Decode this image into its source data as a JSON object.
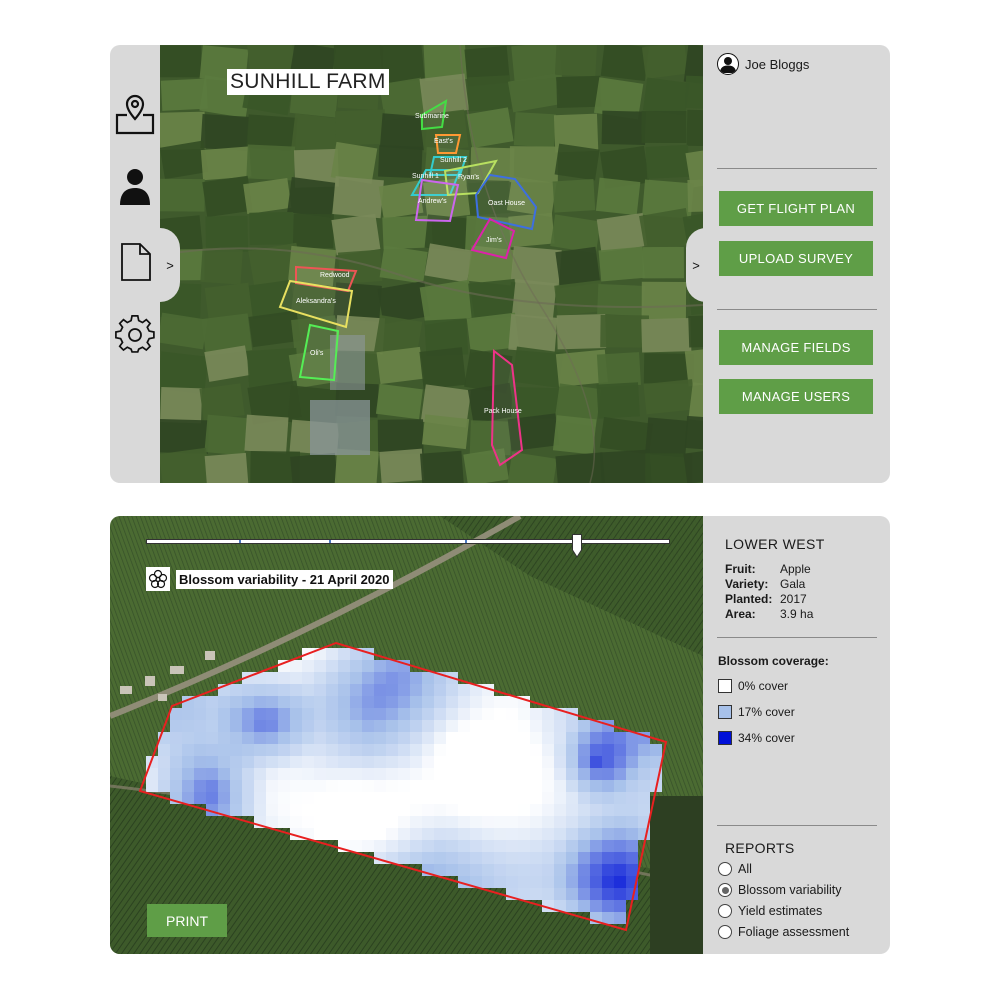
{
  "top_panel": {
    "farm_name": "SUNHILL FARM",
    "user_name": "Joe Bloggs",
    "nav_icons": [
      "map-pin-icon",
      "user-icon",
      "document-icon",
      "gear-icon"
    ],
    "left_toggle": ">",
    "right_toggle": ">",
    "buttons": {
      "get_flight_plan": "GET FLIGHT PLAN",
      "upload_survey": "UPLOAD SURVEY",
      "manage_fields": "MANAGE FIELDS",
      "manage_users": "MANAGE USERS"
    },
    "fields": [
      "Submarine",
      "East's",
      "Sunhill 2",
      "Sunhill 1",
      "Ryan's",
      "Andrew's",
      "Oast House",
      "Jim's",
      "Redwood",
      "Aleksandra's",
      "Oli's",
      "Pack House"
    ]
  },
  "bottom_panel": {
    "caption": "Blossom variability - 21 April 2020",
    "print_label": "PRINT",
    "field": {
      "name": "LOWER WEST",
      "fruit_label": "Fruit:",
      "fruit": "Apple",
      "variety_label": "Variety:",
      "variety": "Gala",
      "planted_label": "Planted:",
      "planted": "2017",
      "area_label": "Area:",
      "area": "3.9 ha"
    },
    "legend": {
      "title": "Blossom coverage:",
      "items": [
        {
          "label": "0% cover",
          "color": "#ffffff"
        },
        {
          "label": "17% cover",
          "color": "#a7c1ea"
        },
        {
          "label": "34% cover",
          "color": "#0010d8"
        }
      ]
    },
    "reports": {
      "title": "REPORTS",
      "options": [
        "All",
        "Blossom variability",
        "Yield estimates",
        "Foliage assessment"
      ],
      "selected": "Blossom variability"
    },
    "timeline_slider": {
      "position": 0.82
    }
  },
  "colors": {
    "accent_green": "#5f9e47",
    "panel_bg": "#d9d9d9"
  }
}
